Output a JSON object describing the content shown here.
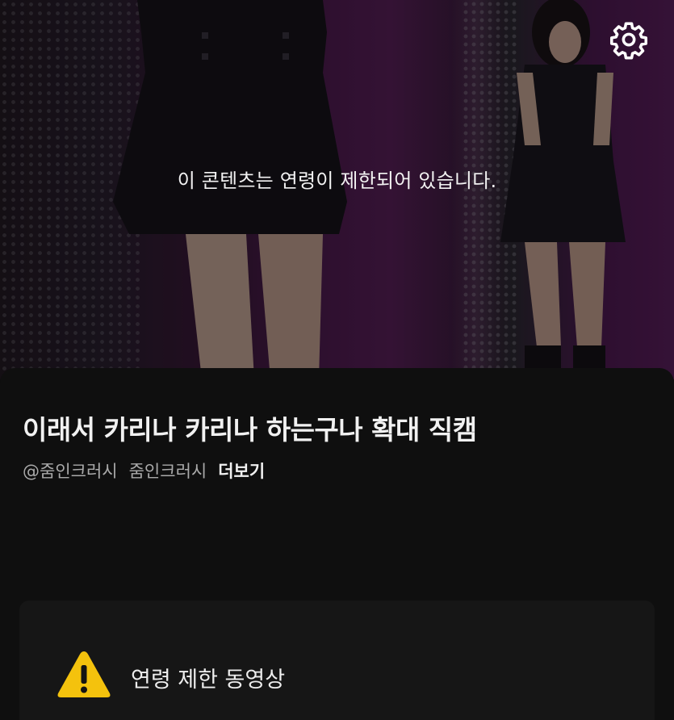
{
  "player": {
    "restricted_notice": "이 콘텐츠는 연령이 제한되어 있습니다.",
    "settings_icon": "gear-icon"
  },
  "video": {
    "title": "이래서 카리나 카리나 하는구나 확대 직캠",
    "channel_handle": "@줌인크러시",
    "channel_name": "줌인크러시",
    "more_label": "더보기"
  },
  "age_restriction": {
    "icon": "warning-icon",
    "icon_color": "#f4c20d",
    "label": "연령 제한 동영상"
  },
  "colors": {
    "background": "#0f0f0f",
    "card": "#161616",
    "text_primary": "#f1f1f1",
    "text_secondary": "#aaaaaa"
  }
}
